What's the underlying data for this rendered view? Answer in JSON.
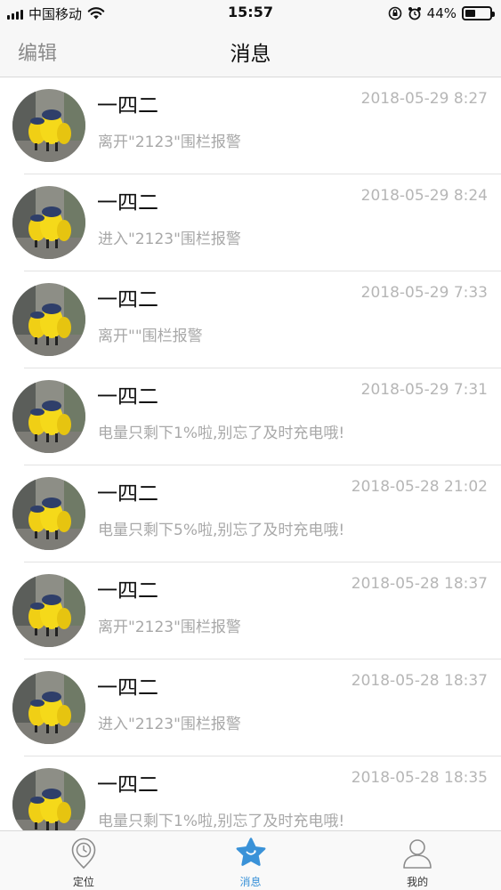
{
  "status_bar": {
    "carrier": "中国移动",
    "time": "15:57",
    "battery": "44%",
    "battery_level": 0.44
  },
  "nav": {
    "edit_label": "编辑",
    "title": "消息"
  },
  "messages": [
    {
      "name": "一四二",
      "time": "2018-05-29 8:27",
      "text": "离开\"2123\"围栏报警"
    },
    {
      "name": "一四二",
      "time": "2018-05-29 8:24",
      "text": "进入\"2123\"围栏报警"
    },
    {
      "name": "一四二",
      "time": "2018-05-29 7:33",
      "text": "离开\"\"围栏报警"
    },
    {
      "name": "一四二",
      "time": "2018-05-29 7:31",
      "text": "电量只剩下1%啦,别忘了及时充电哦!"
    },
    {
      "name": "一四二",
      "time": "2018-05-28 21:02",
      "text": "电量只剩下5%啦,别忘了及时充电哦!"
    },
    {
      "name": "一四二",
      "time": "2018-05-28 18:37",
      "text": "离开\"2123\"围栏报警"
    },
    {
      "name": "一四二",
      "time": "2018-05-28 18:37",
      "text": "进入\"2123\"围栏报警"
    },
    {
      "name": "一四二",
      "time": "2018-05-28 18:35",
      "text": "电量只剩下1%啦,别忘了及时充电哦!"
    }
  ],
  "tabs": [
    {
      "label": "定位",
      "icon": "location-pin-icon"
    },
    {
      "label": "消息",
      "icon": "message-star-icon"
    },
    {
      "label": "我的",
      "icon": "person-icon"
    }
  ],
  "colors": {
    "accent": "#3a92d8",
    "secondary_text": "#a8a8a8"
  }
}
